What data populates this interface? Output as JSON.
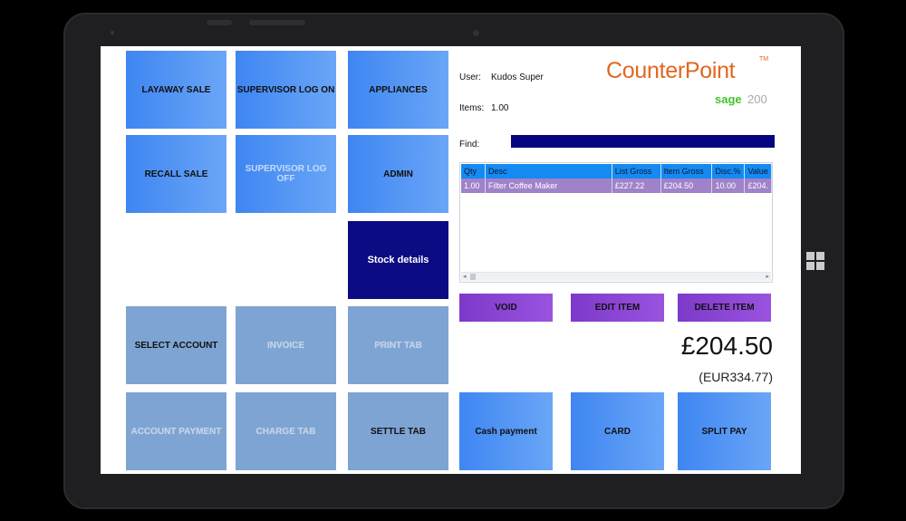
{
  "tiles": {
    "layaway_sale": "LAYAWAY SALE",
    "supervisor_log_on": "SUPERVISOR LOG ON",
    "appliances": "APPLIANCES",
    "recall_sale": "RECALL SALE",
    "supervisor_log_off": "SUPERVISOR LOG OFF",
    "admin": "ADMIN",
    "stock_details": "Stock details",
    "select_account": "SELECT ACCOUNT",
    "invoice": "INVOICE",
    "print_tab": "PRINT TAB",
    "account_payment": "ACCOUNT PAYMENT",
    "charge_tab": "CHARGE TAB",
    "settle_tab": "SETTLE TAB"
  },
  "session": {
    "user_label": "User:",
    "user_value": "Kudos Super",
    "items_label": "Items:",
    "items_value": "1.00",
    "find_label": "Find:"
  },
  "branding": {
    "product": "CounterPoint",
    "trademark": "TM",
    "sage": "sage",
    "sage_version": "200"
  },
  "grid": {
    "columns": [
      "Qty",
      "Desc",
      "List Gross",
      "Item Gross",
      "Disc.%",
      "Value"
    ],
    "rows": [
      [
        "1.00",
        "Filter Coffee Maker",
        "£227.22",
        "£204.50",
        "10.00",
        "£204."
      ]
    ]
  },
  "actions": {
    "void": "VOID",
    "edit_item": "EDIT ITEM",
    "delete_item": "DELETE ITEM"
  },
  "totals": {
    "total": "£204.50",
    "alt_currency": "(EUR334.77)"
  },
  "payments": {
    "cash": "Cash payment",
    "card": "CARD",
    "split": "SPLIT PAY"
  },
  "colors": {
    "tile_blue": "#3f86f2",
    "tile_disabled": "#7ea4d3",
    "stock_details": "#0d0b83",
    "action_purple": "#7d39c9",
    "logo_orange": "#e2661f",
    "sage_green": "#43c42a"
  },
  "icons": {
    "device_os": "windows-icon"
  }
}
